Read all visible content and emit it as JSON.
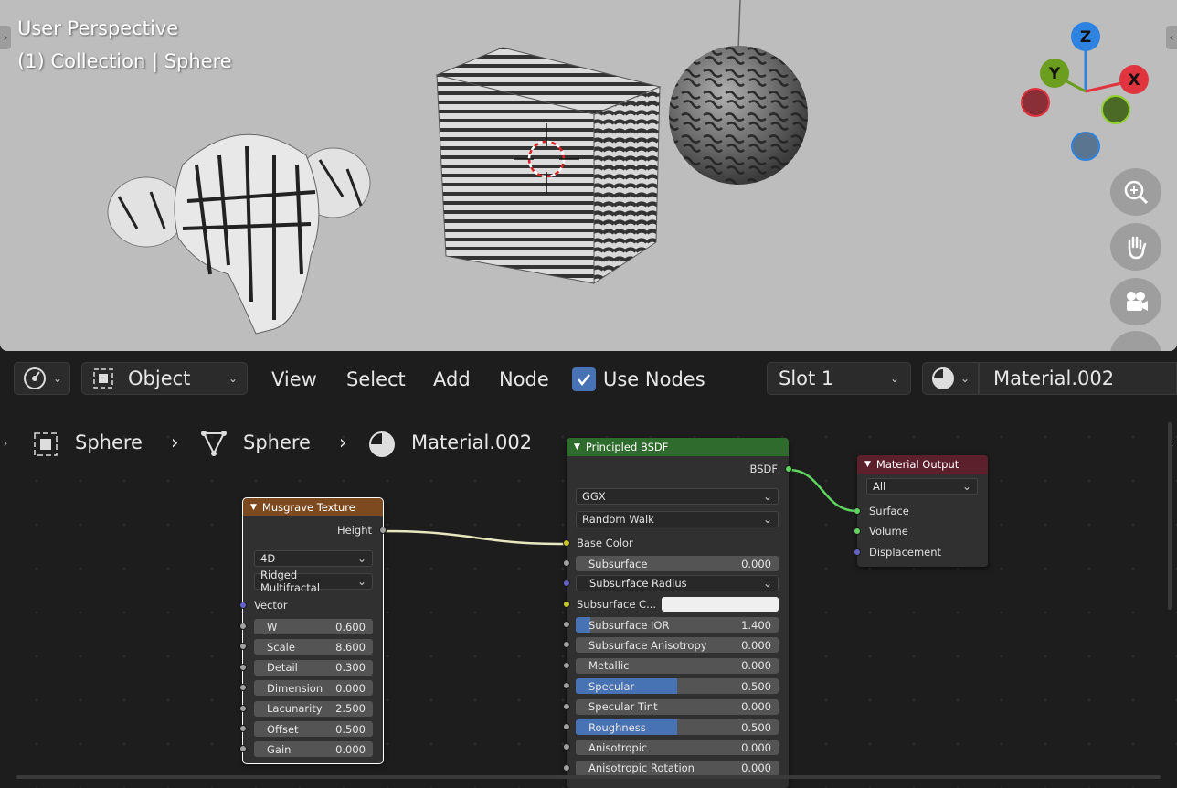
{
  "viewport": {
    "perspective_label": "User Perspective",
    "collection_label": "(1) Collection | Sphere",
    "gizmo": {
      "z": "Z",
      "y": "Y",
      "x": "X"
    }
  },
  "header": {
    "mode": "Object",
    "menu": [
      "View",
      "Select",
      "Add",
      "Node"
    ],
    "use_nodes_label": "Use Nodes",
    "use_nodes_checked": true,
    "slot": "Slot 1",
    "material": "Material.002"
  },
  "breadcrumb": {
    "object": "Sphere",
    "mesh": "Sphere",
    "material": "Material.002"
  },
  "musgrave": {
    "title": "Musgrave Texture",
    "output": "Height",
    "dimensions": "4D",
    "type": "Ridged Multifractal",
    "vector": "Vector",
    "fields": [
      {
        "label": "W",
        "value": "0.600"
      },
      {
        "label": "Scale",
        "value": "8.600"
      },
      {
        "label": "Detail",
        "value": "0.300"
      },
      {
        "label": "Dimension",
        "value": "0.000"
      },
      {
        "label": "Lacunarity",
        "value": "2.500"
      },
      {
        "label": "Offset",
        "value": "0.500"
      },
      {
        "label": "Gain",
        "value": "0.000"
      }
    ]
  },
  "bsdf": {
    "title": "Principled BSDF",
    "output": "BSDF",
    "distribution": "GGX",
    "subsurface_method": "Random Walk",
    "base_color": "Base Color",
    "subsurface": {
      "label": "Subsurface",
      "value": "0.000"
    },
    "subsurface_radius": "Subsurface Radius",
    "subsurface_color": "Subsurface C...",
    "fields": [
      {
        "label": "Subsurface IOR",
        "value": "1.400",
        "fill": 0.07
      },
      {
        "label": "Subsurface Anisotropy",
        "value": "0.000",
        "fill": 0
      },
      {
        "label": "Metallic",
        "value": "0.000",
        "fill": 0
      },
      {
        "label": "Specular",
        "value": "0.500",
        "fill": 0.5
      },
      {
        "label": "Specular Tint",
        "value": "0.000",
        "fill": 0
      },
      {
        "label": "Roughness",
        "value": "0.500",
        "fill": 0.5
      },
      {
        "label": "Anisotropic",
        "value": "0.000",
        "fill": 0
      },
      {
        "label": "Anisotropic Rotation",
        "value": "0.000",
        "fill": 0
      }
    ]
  },
  "output": {
    "title": "Material Output",
    "target": "All",
    "inputs": [
      "Surface",
      "Volume",
      "Displacement"
    ]
  },
  "colors": {
    "texture_header": "#7c4a1e",
    "shader_header": "#2f6b2d",
    "output_header": "#5c1f2c",
    "accent": "#4772b3",
    "shader_socket": "#5fd45f",
    "color_socket": "#c7c729",
    "vector_socket": "#6363c7",
    "value_socket": "#a1a1a1"
  }
}
